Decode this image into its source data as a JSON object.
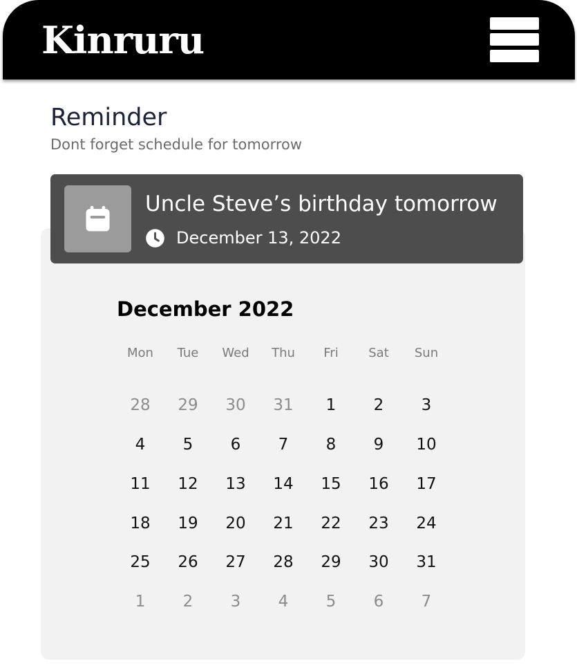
{
  "app": {
    "logo": "Kinruru"
  },
  "reminder": {
    "title": "Reminder",
    "subtitle": "Dont forget schedule for tomorrow"
  },
  "card": {
    "title": "Uncle Steve’s birthday tomorrow",
    "date": "December 13, 2022",
    "icon": "calendar-icon",
    "time_icon": "clock-icon"
  },
  "calendar": {
    "month_label": "December 2022",
    "weekdays": [
      "Mon",
      "Tue",
      "Wed",
      "Thu",
      "Fri",
      "Sat",
      "Sun"
    ],
    "weeks": [
      [
        {
          "d": "28",
          "m": true
        },
        {
          "d": "29",
          "m": true
        },
        {
          "d": "30",
          "m": true
        },
        {
          "d": "31",
          "m": true
        },
        {
          "d": "1",
          "m": false
        },
        {
          "d": "2",
          "m": false
        },
        {
          "d": "3",
          "m": false
        }
      ],
      [
        {
          "d": "4",
          "m": false
        },
        {
          "d": "5",
          "m": false
        },
        {
          "d": "6",
          "m": false
        },
        {
          "d": "7",
          "m": false
        },
        {
          "d": "8",
          "m": false
        },
        {
          "d": "9",
          "m": false
        },
        {
          "d": "10",
          "m": false
        }
      ],
      [
        {
          "d": "11",
          "m": false
        },
        {
          "d": "12",
          "m": false
        },
        {
          "d": "13",
          "m": false
        },
        {
          "d": "14",
          "m": false
        },
        {
          "d": "15",
          "m": false
        },
        {
          "d": "16",
          "m": false
        },
        {
          "d": "17",
          "m": false
        }
      ],
      [
        {
          "d": "18",
          "m": false
        },
        {
          "d": "19",
          "m": false
        },
        {
          "d": "20",
          "m": false
        },
        {
          "d": "21",
          "m": false
        },
        {
          "d": "22",
          "m": false
        },
        {
          "d": "23",
          "m": false
        },
        {
          "d": "24",
          "m": false
        }
      ],
      [
        {
          "d": "25",
          "m": false
        },
        {
          "d": "26",
          "m": false
        },
        {
          "d": "27",
          "m": false
        },
        {
          "d": "28",
          "m": false
        },
        {
          "d": "29",
          "m": false
        },
        {
          "d": "30",
          "m": false
        },
        {
          "d": "31",
          "m": false
        }
      ],
      [
        {
          "d": "1",
          "m": true
        },
        {
          "d": "2",
          "m": true
        },
        {
          "d": "3",
          "m": true
        },
        {
          "d": "4",
          "m": true
        },
        {
          "d": "5",
          "m": true
        },
        {
          "d": "6",
          "m": true
        },
        {
          "d": "7",
          "m": true
        }
      ]
    ]
  },
  "colors": {
    "header": "#000000",
    "card": "#4d4d4d",
    "panel": "#f2f2f2",
    "title": "#1c2336"
  }
}
